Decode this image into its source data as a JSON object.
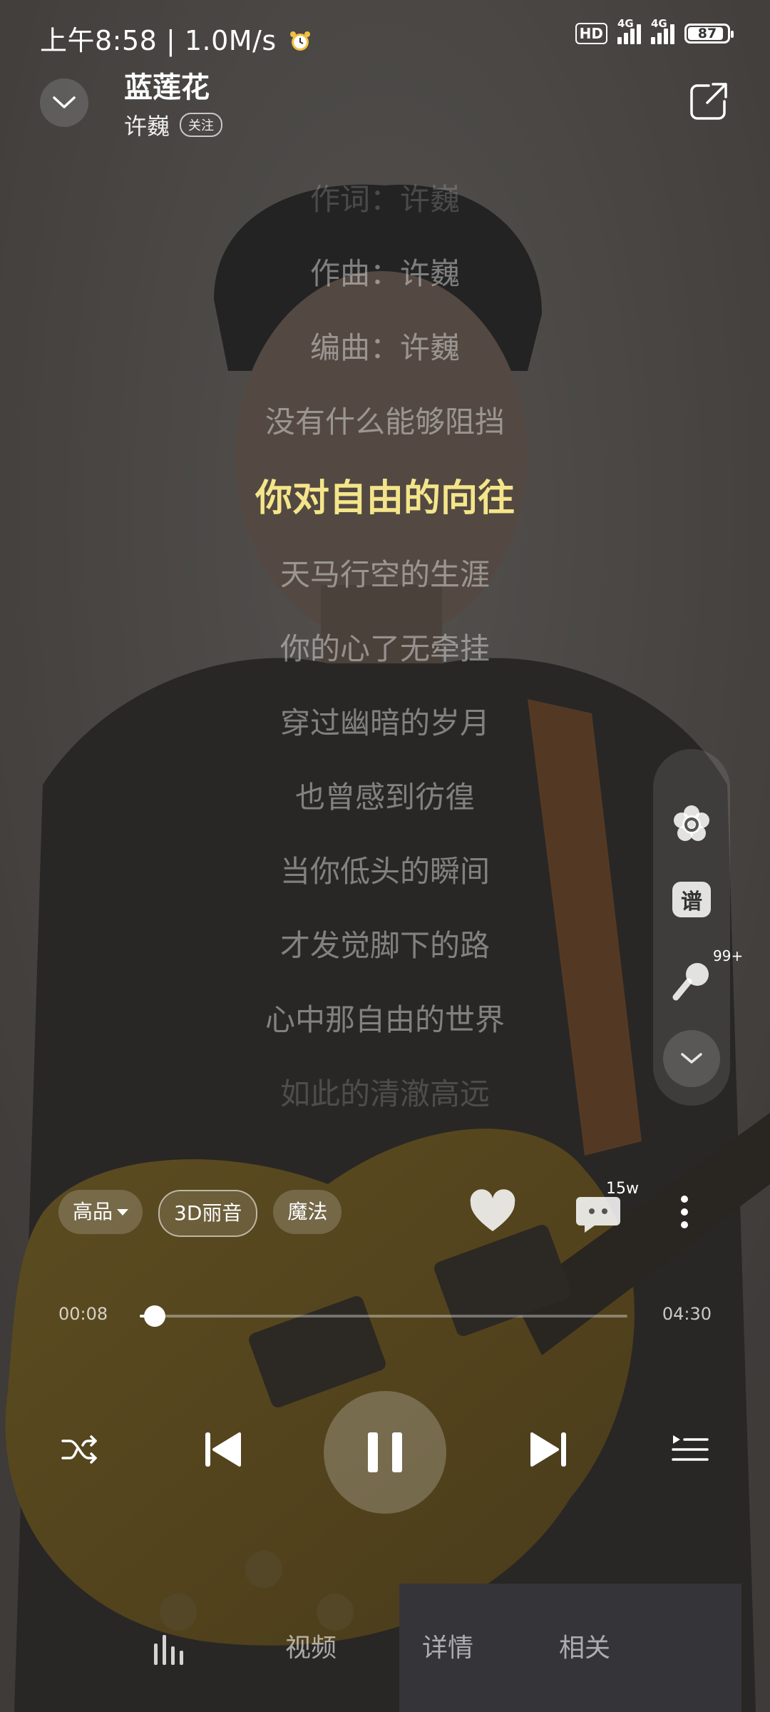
{
  "status_bar": {
    "time": "上午8:58",
    "net_speed": "1.0M/s",
    "hd_label": "HD",
    "network1": "4G",
    "network2": "4G",
    "battery": "87",
    "battery_level": 0.87,
    "alarm_icon": "alarm-clock-icon"
  },
  "header": {
    "title": "蓝莲花",
    "artist": "许巍",
    "follow_label": "关注"
  },
  "lyrics": {
    "lines": [
      "作词：许巍",
      "作曲：许巍",
      "编曲：许巍",
      "没有什么能够阻挡",
      "你对自由的向往",
      "天马行空的生涯",
      "你的心了无牵挂",
      "穿过幽暗的岁月",
      "也曾感到彷徨",
      "当你低头的瞬间",
      "才发觉脚下的路",
      "心中那自由的世界",
      "如此的清澈高远"
    ],
    "active_index": 4
  },
  "side_tools": {
    "score_label": "谱",
    "singing_count": "99+",
    "icons": [
      "flower-settings-icon",
      "score-icon",
      "microphone-icon",
      "chevron-down-icon"
    ]
  },
  "controls": {
    "quality": "高品",
    "effect_3d": "3D丽音",
    "magic": "魔法",
    "comment_count": "15w",
    "current_time": "00:08",
    "total_time": "04:30",
    "progress": 0.03,
    "accent": "#f5e58a"
  },
  "tabs": {
    "video": "视频",
    "details": "详情",
    "related": "相关"
  }
}
